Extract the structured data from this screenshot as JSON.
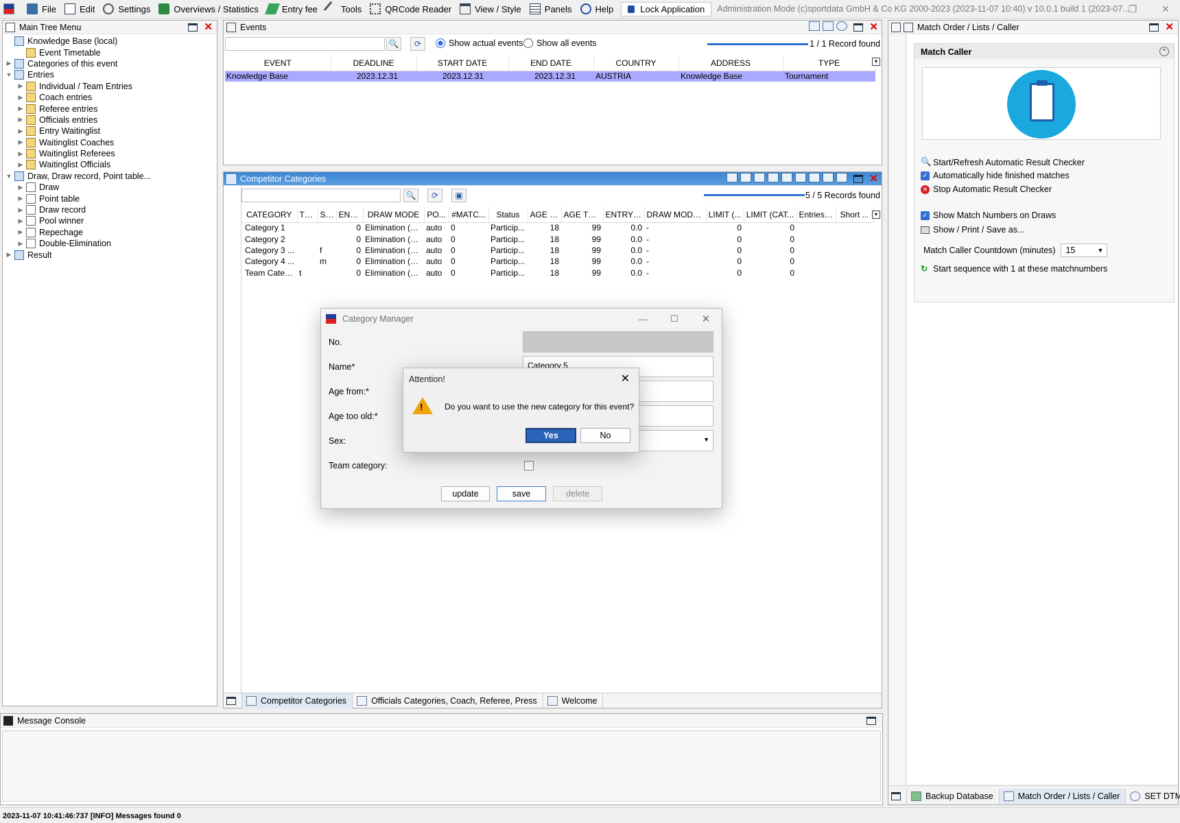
{
  "menubar": {
    "items": [
      "File",
      "Edit",
      "Settings",
      "Overviews / Statistics",
      "Entry fee",
      "Tools",
      "QRCode Reader",
      "View / Style",
      "Panels",
      "Help"
    ],
    "lock_label": "Lock Application",
    "admin_text": "Administration Mode (c)sportdata GmbH & Co KG 2000-2023 (2023-11-07 10:40)  v 10.0.1 build 1 (2023-07..."
  },
  "tree_panel": {
    "title": "Main Tree Menu",
    "items": [
      {
        "label": "Knowledge Base (local)",
        "level": 0,
        "arrow": ""
      },
      {
        "label": "Event Timetable",
        "level": 1,
        "arrow": ""
      },
      {
        "label": "Categories of this event",
        "level": 0,
        "arrow": "▶"
      },
      {
        "label": "Entries",
        "level": 0,
        "arrow": "▼"
      },
      {
        "label": "Individual / Team Entries",
        "level": 1,
        "arrow": "▶"
      },
      {
        "label": "Coach entries",
        "level": 1,
        "arrow": "▶"
      },
      {
        "label": "Referee entries",
        "level": 1,
        "arrow": "▶"
      },
      {
        "label": "Officials entries",
        "level": 1,
        "arrow": "▶"
      },
      {
        "label": "Entry Waitinglist",
        "level": 1,
        "arrow": "▶"
      },
      {
        "label": "Waitinglist Coaches",
        "level": 1,
        "arrow": "▶"
      },
      {
        "label": "Waitinglist Referees",
        "level": 1,
        "arrow": "▶"
      },
      {
        "label": "Waitinglist Officials",
        "level": 1,
        "arrow": "▶"
      },
      {
        "label": "Draw, Draw record, Point table...",
        "level": 0,
        "arrow": "▼"
      },
      {
        "label": "Draw",
        "level": 1,
        "arrow": "▶"
      },
      {
        "label": "Point table",
        "level": 1,
        "arrow": "▶"
      },
      {
        "label": "Draw record",
        "level": 1,
        "arrow": "▶"
      },
      {
        "label": "Pool winner",
        "level": 1,
        "arrow": "▶"
      },
      {
        "label": "Repechage",
        "level": 1,
        "arrow": "▶"
      },
      {
        "label": "Double-Elimination",
        "level": 1,
        "arrow": "▶"
      },
      {
        "label": "Result",
        "level": 0,
        "arrow": "▶"
      }
    ]
  },
  "events_panel": {
    "title": "Events",
    "radio_actual": "Show actual events",
    "radio_all": "Show all events",
    "record_count": "1 / 1 Record found",
    "columns": [
      "EVENT",
      "DEADLINE",
      "START DATE",
      "END DATE",
      "COUNTRY",
      "ADDRESS",
      "TYPE"
    ],
    "rows": [
      [
        "Knowledge Base",
        "2023.12.31",
        "2023.12.31",
        "2023.12.31",
        "AUSTRIA",
        "Knowledge Base",
        "Tournament"
      ]
    ]
  },
  "categories_panel": {
    "title": "Competitor Categories",
    "record_count": "5 / 5 Records found",
    "columns": [
      "CATEGORY",
      "TE...",
      "SEX",
      "ENT...",
      "DRAW MODE",
      "PO...",
      "#MATC...",
      "Status",
      "AGE F...",
      "AGE TO...",
      "ENTRY F...",
      "DRAW MODE...",
      "LIMIT (...",
      "LIMIT (CAT...",
      "Entries ...",
      "Short ..."
    ],
    "rows": [
      [
        "Category 1",
        "",
        "",
        "0",
        "Elimination (K...",
        "auto",
        "0",
        "Particip...",
        "18",
        "99",
        "0.0",
        "-",
        "0",
        "0",
        "",
        ""
      ],
      [
        "Category 2",
        "",
        "",
        "0",
        "Elimination (K...",
        "auto",
        "0",
        "Particip...",
        "18",
        "99",
        "0.0",
        "-",
        "0",
        "0",
        "",
        ""
      ],
      [
        "Category 3 ...",
        "",
        "f",
        "0",
        "Elimination (K...",
        "auto",
        "0",
        "Particip...",
        "18",
        "99",
        "0.0",
        "-",
        "0",
        "0",
        "",
        ""
      ],
      [
        "Category 4 ...",
        "",
        "m",
        "0",
        "Elimination (K...",
        "auto",
        "0",
        "Particip...",
        "18",
        "99",
        "0.0",
        "-",
        "0",
        "0",
        "",
        ""
      ],
      [
        "Team Categ...",
        "t",
        "",
        "0",
        "Elimination (K...",
        "auto",
        "0",
        "Particip...",
        "18",
        "99",
        "0.0",
        "-",
        "0",
        "0",
        "",
        ""
      ]
    ],
    "tabs": [
      "Competitor Categories",
      "Officials Categories, Coach, Referee, Press",
      "Welcome"
    ]
  },
  "category_manager": {
    "title": "Category Manager",
    "labels": {
      "no": "No.",
      "name": "Name*",
      "age_from": "Age from:*",
      "age_too_old": "Age too old:*",
      "sex": "Sex:",
      "team": "Team category:"
    },
    "name_value": "Category 5",
    "buttons": {
      "update": "update",
      "save": "save",
      "delete": "delete"
    }
  },
  "attention_dialog": {
    "title": "Attention!",
    "message": "Do you want to use the new category for this event?",
    "yes": "Yes",
    "no": "No"
  },
  "message_console": {
    "title": "Message Console"
  },
  "right_panel": {
    "title": "Match Order / Lists / Caller",
    "section": "Match Caller",
    "items": {
      "start_refresh": "Start/Refresh Automatic Result Checker",
      "auto_hide": "Automatically hide finished matches",
      "stop_checker": "Stop Automatic Result Checker",
      "show_numbers": "Show Match Numbers on Draws",
      "show_print": "Show / Print / Save as...",
      "countdown_label": "Match Caller Countdown (minutes)",
      "countdown_value": "15",
      "start_sequence": "Start sequence with 1 at these matchnumbers"
    },
    "tabs": [
      "Backup Database",
      "Match Order / Lists / Caller",
      "SET DTM"
    ]
  },
  "status": {
    "text": "2023-11-07 10:41:46:737 [INFO] Messages found 0"
  },
  "colors": {
    "selected_row": "#a9a9ff",
    "title_blue": "#3b86d4",
    "yes_button": "#2a64b8",
    "accent_check": "#2f6fd6"
  }
}
